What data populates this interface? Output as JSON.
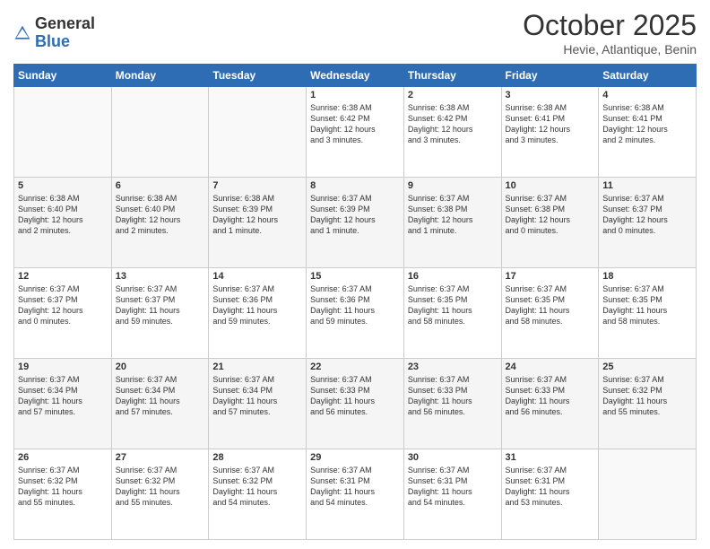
{
  "logo": {
    "general": "General",
    "blue": "Blue"
  },
  "header": {
    "month": "October 2025",
    "location": "Hevie, Atlantique, Benin"
  },
  "days_of_week": [
    "Sunday",
    "Monday",
    "Tuesday",
    "Wednesday",
    "Thursday",
    "Friday",
    "Saturday"
  ],
  "weeks": [
    [
      {
        "day": "",
        "info": ""
      },
      {
        "day": "",
        "info": ""
      },
      {
        "day": "",
        "info": ""
      },
      {
        "day": "1",
        "info": "Sunrise: 6:38 AM\nSunset: 6:42 PM\nDaylight: 12 hours\nand 3 minutes."
      },
      {
        "day": "2",
        "info": "Sunrise: 6:38 AM\nSunset: 6:42 PM\nDaylight: 12 hours\nand 3 minutes."
      },
      {
        "day": "3",
        "info": "Sunrise: 6:38 AM\nSunset: 6:41 PM\nDaylight: 12 hours\nand 3 minutes."
      },
      {
        "day": "4",
        "info": "Sunrise: 6:38 AM\nSunset: 6:41 PM\nDaylight: 12 hours\nand 2 minutes."
      }
    ],
    [
      {
        "day": "5",
        "info": "Sunrise: 6:38 AM\nSunset: 6:40 PM\nDaylight: 12 hours\nand 2 minutes."
      },
      {
        "day": "6",
        "info": "Sunrise: 6:38 AM\nSunset: 6:40 PM\nDaylight: 12 hours\nand 2 minutes."
      },
      {
        "day": "7",
        "info": "Sunrise: 6:38 AM\nSunset: 6:39 PM\nDaylight: 12 hours\nand 1 minute."
      },
      {
        "day": "8",
        "info": "Sunrise: 6:37 AM\nSunset: 6:39 PM\nDaylight: 12 hours\nand 1 minute."
      },
      {
        "day": "9",
        "info": "Sunrise: 6:37 AM\nSunset: 6:38 PM\nDaylight: 12 hours\nand 1 minute."
      },
      {
        "day": "10",
        "info": "Sunrise: 6:37 AM\nSunset: 6:38 PM\nDaylight: 12 hours\nand 0 minutes."
      },
      {
        "day": "11",
        "info": "Sunrise: 6:37 AM\nSunset: 6:37 PM\nDaylight: 12 hours\nand 0 minutes."
      }
    ],
    [
      {
        "day": "12",
        "info": "Sunrise: 6:37 AM\nSunset: 6:37 PM\nDaylight: 12 hours\nand 0 minutes."
      },
      {
        "day": "13",
        "info": "Sunrise: 6:37 AM\nSunset: 6:37 PM\nDaylight: 11 hours\nand 59 minutes."
      },
      {
        "day": "14",
        "info": "Sunrise: 6:37 AM\nSunset: 6:36 PM\nDaylight: 11 hours\nand 59 minutes."
      },
      {
        "day": "15",
        "info": "Sunrise: 6:37 AM\nSunset: 6:36 PM\nDaylight: 11 hours\nand 59 minutes."
      },
      {
        "day": "16",
        "info": "Sunrise: 6:37 AM\nSunset: 6:35 PM\nDaylight: 11 hours\nand 58 minutes."
      },
      {
        "day": "17",
        "info": "Sunrise: 6:37 AM\nSunset: 6:35 PM\nDaylight: 11 hours\nand 58 minutes."
      },
      {
        "day": "18",
        "info": "Sunrise: 6:37 AM\nSunset: 6:35 PM\nDaylight: 11 hours\nand 58 minutes."
      }
    ],
    [
      {
        "day": "19",
        "info": "Sunrise: 6:37 AM\nSunset: 6:34 PM\nDaylight: 11 hours\nand 57 minutes."
      },
      {
        "day": "20",
        "info": "Sunrise: 6:37 AM\nSunset: 6:34 PM\nDaylight: 11 hours\nand 57 minutes."
      },
      {
        "day": "21",
        "info": "Sunrise: 6:37 AM\nSunset: 6:34 PM\nDaylight: 11 hours\nand 57 minutes."
      },
      {
        "day": "22",
        "info": "Sunrise: 6:37 AM\nSunset: 6:33 PM\nDaylight: 11 hours\nand 56 minutes."
      },
      {
        "day": "23",
        "info": "Sunrise: 6:37 AM\nSunset: 6:33 PM\nDaylight: 11 hours\nand 56 minutes."
      },
      {
        "day": "24",
        "info": "Sunrise: 6:37 AM\nSunset: 6:33 PM\nDaylight: 11 hours\nand 56 minutes."
      },
      {
        "day": "25",
        "info": "Sunrise: 6:37 AM\nSunset: 6:32 PM\nDaylight: 11 hours\nand 55 minutes."
      }
    ],
    [
      {
        "day": "26",
        "info": "Sunrise: 6:37 AM\nSunset: 6:32 PM\nDaylight: 11 hours\nand 55 minutes."
      },
      {
        "day": "27",
        "info": "Sunrise: 6:37 AM\nSunset: 6:32 PM\nDaylight: 11 hours\nand 55 minutes."
      },
      {
        "day": "28",
        "info": "Sunrise: 6:37 AM\nSunset: 6:32 PM\nDaylight: 11 hours\nand 54 minutes."
      },
      {
        "day": "29",
        "info": "Sunrise: 6:37 AM\nSunset: 6:31 PM\nDaylight: 11 hours\nand 54 minutes."
      },
      {
        "day": "30",
        "info": "Sunrise: 6:37 AM\nSunset: 6:31 PM\nDaylight: 11 hours\nand 54 minutes."
      },
      {
        "day": "31",
        "info": "Sunrise: 6:37 AM\nSunset: 6:31 PM\nDaylight: 11 hours\nand 53 minutes."
      },
      {
        "day": "",
        "info": ""
      }
    ]
  ]
}
